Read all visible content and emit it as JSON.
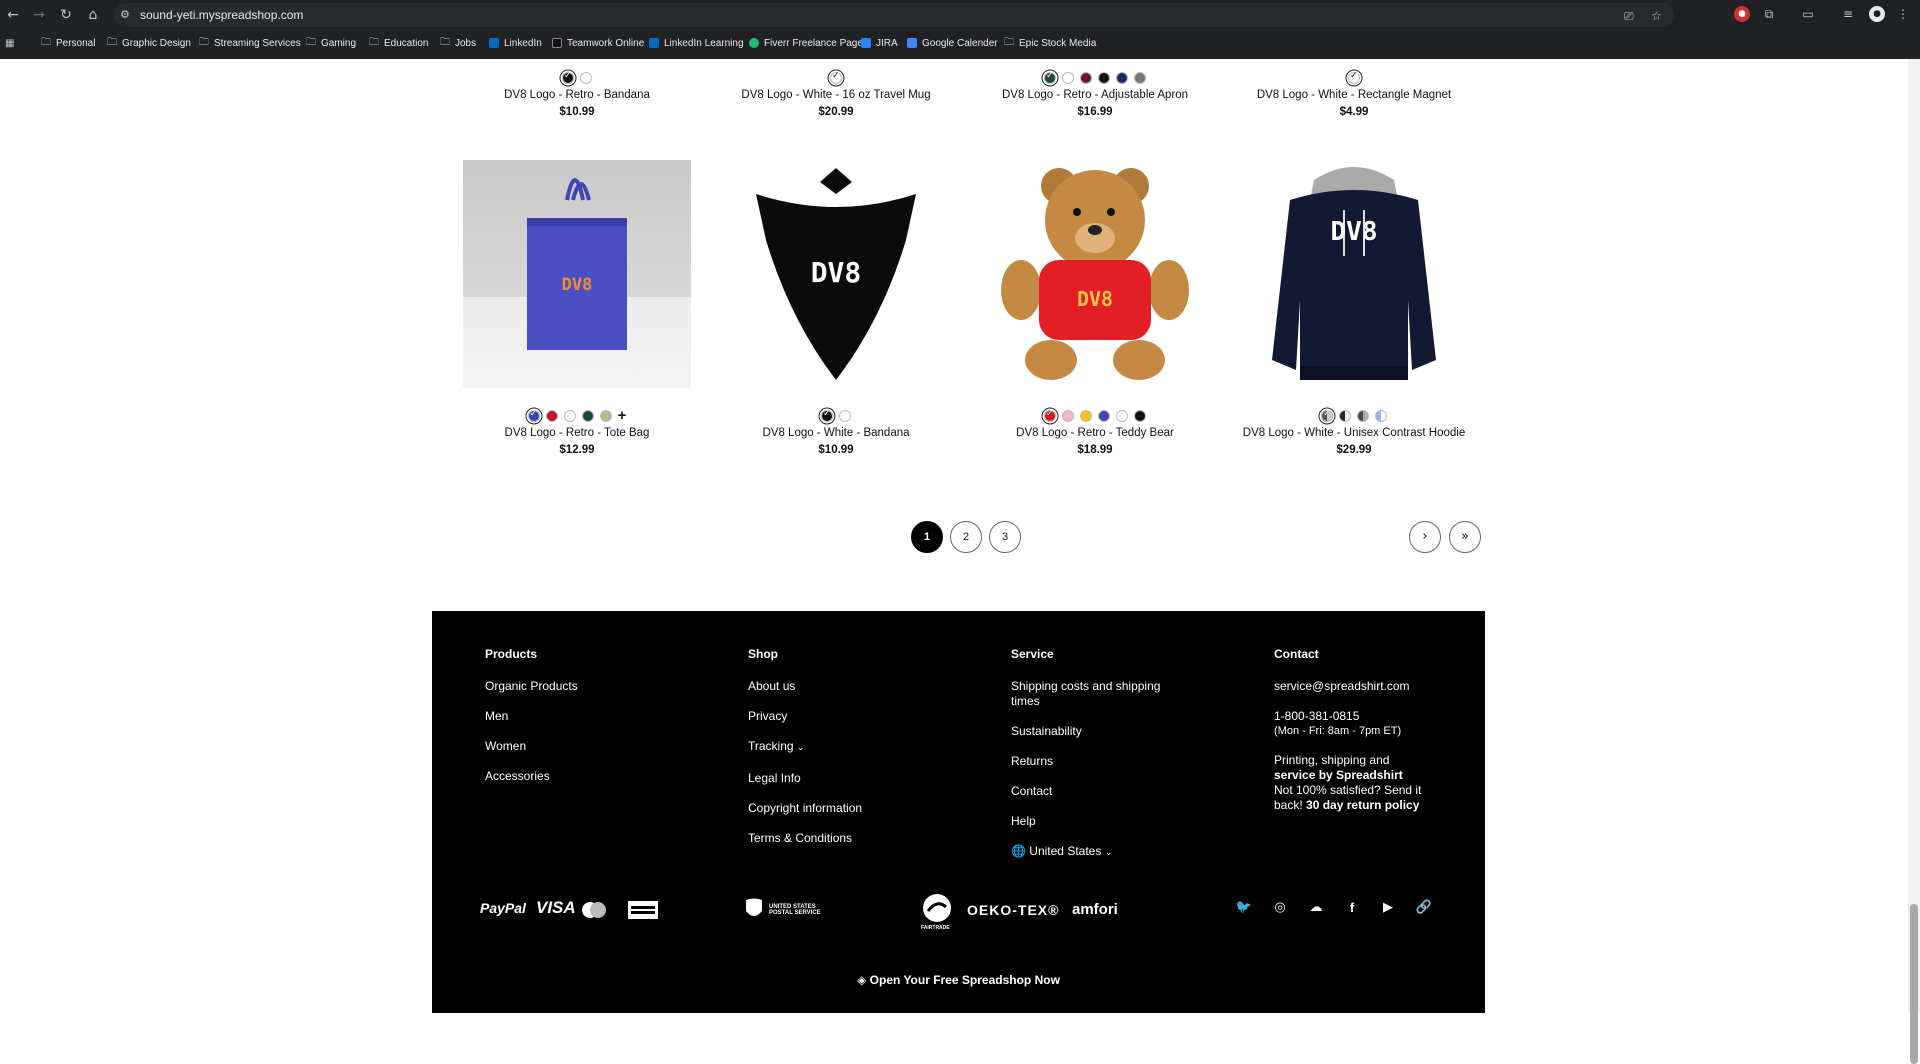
{
  "browser": {
    "url": "sound-yeti.myspreadshop.com",
    "bookmarks": [
      {
        "label": "Personal",
        "icon": "folder-icon"
      },
      {
        "label": "Graphic Design",
        "icon": "folder-icon"
      },
      {
        "label": "Streaming Services",
        "icon": "folder-icon"
      },
      {
        "label": "Gaming",
        "icon": "folder-icon"
      },
      {
        "label": "Education",
        "icon": "folder-icon"
      },
      {
        "label": "Jobs",
        "icon": "folder-icon"
      },
      {
        "label": "LinkedIn",
        "icon": "linkedin-icon"
      },
      {
        "label": "Teamwork Online",
        "icon": "teamwork-icon"
      },
      {
        "label": "LinkedIn Learning",
        "icon": "linkedin-learning-icon"
      },
      {
        "label": "Fiverr Freelance Page",
        "icon": "fiverr-icon"
      },
      {
        "label": "JIRA",
        "icon": "jira-icon"
      },
      {
        "label": "Google Calender",
        "icon": "google-calendar-icon"
      },
      {
        "label": "Epic Stock Media",
        "icon": "folder-icon"
      }
    ]
  },
  "top_row": [
    {
      "name": "DV8 Logo - Retro - Bandana",
      "price": "$10.99",
      "colors": [
        "#111111",
        "#ffffff"
      ]
    },
    {
      "name": "DV8 Logo - White - 16 oz Travel Mug",
      "price": "$20.99",
      "colors": [
        "#ffffff"
      ]
    },
    {
      "name": "DV8 Logo - Retro - Adjustable Apron",
      "price": "$16.99",
      "colors": [
        "#1f4a2e",
        "#ffffff",
        "#7a0f2b",
        "#111111",
        "#1c2a5a",
        "#777777"
      ]
    },
    {
      "name": "DV8 Logo - White - Rectangle Magnet",
      "price": "$4.99",
      "colors": [
        "#ffffff"
      ]
    }
  ],
  "products": [
    {
      "name": "DV8 Logo - Retro - Tote Bag",
      "price": "$12.99",
      "colors": [
        "#3d46b5",
        "#c8102e",
        "#ffffff",
        "#1f4a2e",
        "#b4b98a"
      ],
      "more": "+",
      "image": "tote-bag-image"
    },
    {
      "name": "DV8 Logo - White - Bandana",
      "price": "$10.99",
      "colors": [
        "#111111",
        "#ffffff"
      ],
      "image": "bandana-image"
    },
    {
      "name": "DV8 Logo - Retro - Teddy Bear",
      "price": "$18.99",
      "colors": [
        "#d01b24",
        "#f6b8c4",
        "#f2c21b",
        "#3d46b5",
        "#ffffff",
        "#111111"
      ],
      "image": "teddy-bear-image"
    },
    {
      "name": "DV8 Logo - White - Unisex Contrast Hoodie",
      "price": "$29.99",
      "colors": [
        "#555555",
        "#222222",
        "#3a4a6b",
        "#9ab8e0"
      ],
      "image": "hoodie-image"
    }
  ],
  "logo_text": "DV8",
  "pagination": {
    "pages": [
      "1",
      "2",
      "3"
    ],
    "current": "1",
    "next": "›",
    "last": "»"
  },
  "footer": {
    "products": {
      "title": "Products",
      "links": [
        "Organic Products",
        "Men",
        "Women",
        "Accessories"
      ]
    },
    "shop": {
      "title": "Shop",
      "links": [
        "About us",
        "Privacy",
        "Tracking",
        "Legal Info",
        "Copyright information",
        "Terms & Conditions"
      ]
    },
    "service": {
      "title": "Service",
      "links": [
        "Shipping costs and shipping times",
        "Sustainability",
        "Returns",
        "Contact",
        "Help"
      ],
      "country": "United States"
    },
    "contact": {
      "title": "Contact",
      "email": "service@spreadshirt.com",
      "phone": "1-800-381-0815",
      "hours": "(Mon - Fri: 8am - 7pm ET)",
      "line1": "Printing, shipping and",
      "line2": "service by Spreadshirt",
      "line3": "Not 100% satisfied? Send it",
      "line4a": "back!",
      "line4b": "30 day return policy"
    },
    "payments": [
      "PayPal",
      "VISA"
    ],
    "shipping": [
      "UPS",
      "UNITED STATES POSTAL SERVICE"
    ],
    "certs": [
      "FAIRTRADE",
      "OEKO-TEX®",
      "amfori"
    ],
    "social": [
      "twitter-icon",
      "instagram-icon",
      "soundcloud-icon",
      "facebook-icon",
      "youtube-icon",
      "link-icon"
    ],
    "open_shop": "Open Your Free Spreadshop Now"
  }
}
